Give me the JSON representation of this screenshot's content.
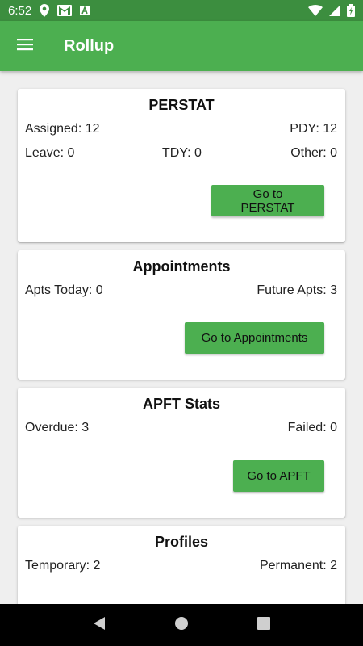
{
  "status_bar": {
    "time": "6:52",
    "icons_left": [
      "location-icon",
      "gmail-icon",
      "app-notification-icon"
    ],
    "icons_right": [
      "wifi-icon",
      "signal-icon",
      "battery-icon"
    ]
  },
  "app_bar": {
    "title": "Rollup",
    "menu_icon": "menu-icon",
    "color": "#4caf50"
  },
  "cards": {
    "perstat": {
      "title": "PERSTAT",
      "assigned": "Assigned: 12",
      "pdy": "PDY: 12",
      "leave": "Leave: 0",
      "tdy": "TDY: 0",
      "other": "Other: 0",
      "button_label": "Go to PERSTAT"
    },
    "appointments": {
      "title": "Appointments",
      "apts_today": "Apts Today: 0",
      "future_apts": "Future Apts: 3",
      "button_label": "Go to Appointments"
    },
    "apft": {
      "title": "APFT Stats",
      "overdue": "Overdue: 3",
      "failed": "Failed: 0",
      "button_label": "Go to APFT"
    },
    "profiles": {
      "title": "Profiles",
      "temporary": "Temporary: 2",
      "permanent": "Permanent: 2"
    }
  },
  "nav_bar": {
    "buttons": [
      "back-icon",
      "home-icon",
      "recents-icon"
    ]
  }
}
